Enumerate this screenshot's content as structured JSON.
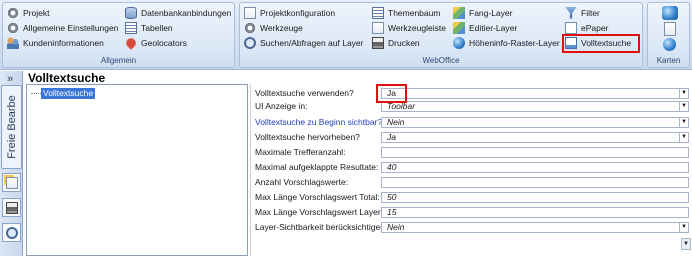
{
  "ribbon": {
    "allgemein": {
      "label": "Allgemein",
      "items": [
        "Projekt",
        "Allgemeine Einstellungen",
        "Kundeninformationen",
        "Datenbankanbindungen",
        "Tabellen",
        "Geolocators"
      ]
    },
    "weboffice": {
      "label": "WebOffice",
      "col1": [
        "Projektkonfiguration",
        "Werkzeuge",
        "Suchen/Abfragen auf Layer"
      ],
      "col2": [
        "Themenbaum",
        "Werkzeugleiste",
        "Drucken"
      ],
      "col3": [
        "Fang-Layer",
        "Editier-Layer",
        "Höheninfo-Raster-Layer"
      ],
      "col4": [
        "Filter",
        "ePaper",
        "Volltextsuche"
      ]
    },
    "karten": {
      "label": "Karten"
    }
  },
  "strip": {
    "expand": "»",
    "tab_label": "Freie Bearbe"
  },
  "page": {
    "title": "Volltextsuche"
  },
  "tree": {
    "selected": "Volltextsuche"
  },
  "properties": [
    {
      "label": "Volltextsuche verwenden?",
      "value": "Ja",
      "dropdown": true,
      "blue": false
    },
    {
      "label": "UI Anzeige in:",
      "value": "Toolbar",
      "dropdown": true,
      "blue": false
    },
    {
      "label": "Volltextsuche zu Beginn sichtbar?",
      "value": "Nein",
      "dropdown": true,
      "blue": true
    },
    {
      "label": "Volltextsuche hervorheben?",
      "value": "Ja",
      "dropdown": true,
      "blue": false
    },
    {
      "label": "Maximale Trefferanzahl:",
      "value": "",
      "dropdown": false,
      "blue": false
    },
    {
      "label": "Maximal aufgeklappte Resultate:",
      "value": "40",
      "dropdown": false,
      "blue": false
    },
    {
      "label": "Anzahl Vorschlagswerte:",
      "value": "",
      "dropdown": false,
      "blue": false
    },
    {
      "label": "Max Länge Vorschlagswert Total:",
      "value": "50",
      "dropdown": false,
      "blue": false
    },
    {
      "label": "Max Länge Vorschlagswert Layer:",
      "value": "15",
      "dropdown": false,
      "blue": false
    },
    {
      "label": "Layer-Sichtbarkeit berücksichtigen?",
      "value": "Nein",
      "dropdown": true,
      "blue": false
    }
  ],
  "colors": {
    "highlight": "#e01010",
    "selection": "#3875d7",
    "link_label": "#1f3fbf"
  }
}
